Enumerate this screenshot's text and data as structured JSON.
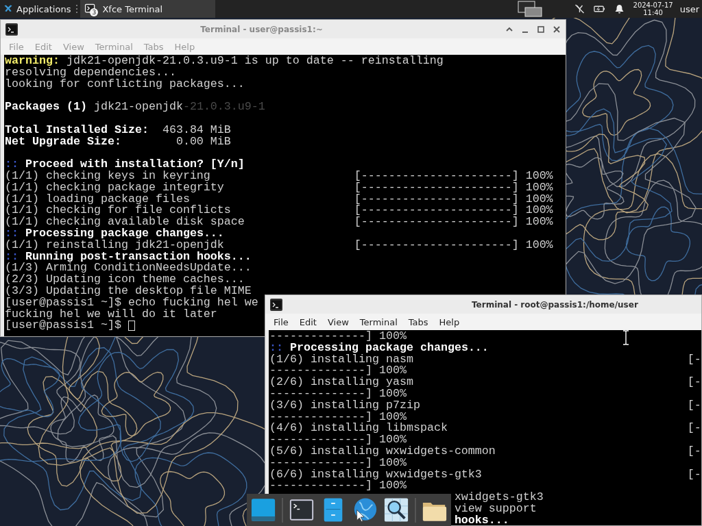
{
  "top_panel": {
    "applications": "Applications",
    "task": {
      "title": "Xfce Terminal",
      "badge": "3"
    },
    "date": "2024-07-17",
    "time": "11:40",
    "user": "user"
  },
  "windows": [
    {
      "title": "Terminal - user@passis1:~",
      "active": false,
      "window_buttons": true,
      "menu": [
        "File",
        "Edit",
        "View",
        "Terminal",
        "Tabs",
        "Help"
      ],
      "lines": [
        {
          "kind": "text",
          "segments": [
            {
              "text": "warning:",
              "kind": "warn"
            },
            {
              "text": " jdk21-openjdk-21.0.3.u9-1 is up to date -- reinstalling",
              "kind": "plain"
            }
          ]
        },
        {
          "kind": "text",
          "segments": [
            {
              "text": "resolving dependencies...",
              "kind": "plain"
            }
          ]
        },
        {
          "kind": "text",
          "segments": [
            {
              "text": "looking for conflicting packages...",
              "kind": "plain"
            }
          ]
        },
        {
          "kind": "blank"
        },
        {
          "kind": "text",
          "segments": [
            {
              "text": "Packages (1)",
              "kind": "bold"
            },
            {
              "text": " jdk21-openjdk",
              "kind": "plain"
            },
            {
              "text": "-21.0.3.u9-1",
              "kind": "dim"
            }
          ]
        },
        {
          "kind": "blank"
        },
        {
          "kind": "text",
          "segments": [
            {
              "text": "Total Installed Size:",
              "kind": "bold"
            },
            {
              "text": "  463.84 MiB",
              "kind": "plain"
            }
          ]
        },
        {
          "kind": "text",
          "segments": [
            {
              "text": "Net Upgrade Size:",
              "kind": "bold"
            },
            {
              "text": "        0.00 MiB",
              "kind": "plain"
            }
          ]
        },
        {
          "kind": "blank"
        },
        {
          "kind": "text",
          "segments": [
            {
              "text": "::",
              "kind": "accent"
            },
            {
              "text": " Proceed with installation? [Y/n]",
              "kind": "bold"
            }
          ]
        },
        {
          "kind": "progress",
          "label": "(1/1) checking keys in keyring",
          "bar": "[----------------------] 100%"
        },
        {
          "kind": "progress",
          "label": "(1/1) checking package integrity",
          "bar": "[----------------------] 100%"
        },
        {
          "kind": "progress",
          "label": "(1/1) loading package files",
          "bar": "[----------------------] 100%"
        },
        {
          "kind": "progress",
          "label": "(1/1) checking for file conflicts",
          "bar": "[----------------------] 100%"
        },
        {
          "kind": "progress",
          "label": "(1/1) checking available disk space",
          "bar": "[----------------------] 100%"
        },
        {
          "kind": "text",
          "segments": [
            {
              "text": "::",
              "kind": "accent"
            },
            {
              "text": " Processing package changes...",
              "kind": "bold"
            }
          ]
        },
        {
          "kind": "progress",
          "label": "(1/1) reinstalling jdk21-openjdk",
          "bar": "[----------------------] 100%"
        },
        {
          "kind": "text",
          "segments": [
            {
              "text": "::",
              "kind": "accent"
            },
            {
              "text": " Running post-transaction hooks...",
              "kind": "bold"
            }
          ]
        },
        {
          "kind": "text",
          "segments": [
            {
              "text": "(1/3) Arming ConditionNeedsUpdate...",
              "kind": "plain"
            }
          ]
        },
        {
          "kind": "text",
          "segments": [
            {
              "text": "(2/3) Updating icon theme caches...",
              "kind": "plain"
            }
          ]
        },
        {
          "kind": "text",
          "segments": [
            {
              "text": "(3/3) Updating the desktop file MIME",
              "kind": "plain"
            }
          ]
        },
        {
          "kind": "text",
          "segments": [
            {
              "text": "[user@passis1 ~]$ echo fucking hel we",
              "kind": "plain"
            }
          ]
        },
        {
          "kind": "text",
          "segments": [
            {
              "text": "fucking hel we will do it later",
              "kind": "plain"
            }
          ]
        },
        {
          "kind": "prompt",
          "segments": [
            {
              "text": "[user@passis1 ~]$",
              "kind": "plain"
            }
          ],
          "cursor": true
        }
      ]
    },
    {
      "title": "Terminal - root@passis1:/home/user",
      "active": true,
      "window_buttons": false,
      "menu": [
        "File",
        "Edit",
        "View",
        "Terminal",
        "Tabs",
        "Help"
      ],
      "lines": [
        {
          "kind": "text",
          "segments": [
            {
              "text": "--------------] 100%",
              "kind": "plain"
            }
          ]
        },
        {
          "kind": "text",
          "segments": [
            {
              "text": "::",
              "kind": "accent"
            },
            {
              "text": " Processing package changes...",
              "kind": "bold"
            }
          ]
        },
        {
          "kind": "progress",
          "label": "(1/6) installing nasm",
          "bar": "[-"
        },
        {
          "kind": "text",
          "segments": [
            {
              "text": "--------------] 100%",
              "kind": "plain"
            }
          ]
        },
        {
          "kind": "progress",
          "label": "(2/6) installing yasm",
          "bar": "[-"
        },
        {
          "kind": "text",
          "segments": [
            {
              "text": "--------------] 100%",
              "kind": "plain"
            }
          ]
        },
        {
          "kind": "progress",
          "label": "(3/6) installing p7zip",
          "bar": "[-"
        },
        {
          "kind": "text",
          "segments": [
            {
              "text": "--------------] 100%",
              "kind": "plain"
            }
          ]
        },
        {
          "kind": "progress",
          "label": "(4/6) installing libmspack",
          "bar": "[-"
        },
        {
          "kind": "text",
          "segments": [
            {
              "text": "--------------] 100%",
              "kind": "plain"
            }
          ]
        },
        {
          "kind": "progress",
          "label": "(5/6) installing wxwidgets-common",
          "bar": "[-"
        },
        {
          "kind": "text",
          "segments": [
            {
              "text": "--------------] 100%",
              "kind": "plain"
            }
          ]
        },
        {
          "kind": "progress",
          "label": "(6/6) installing wxwidgets-gtk3",
          "bar": "[-"
        },
        {
          "kind": "text",
          "segments": [
            {
              "text": "--------------] 100%",
              "kind": "plain"
            }
          ]
        },
        {
          "kind": "tail",
          "segments": [
            {
              "text": "xwidgets-gtk3",
              "kind": "plain"
            }
          ]
        },
        {
          "kind": "tail",
          "segments": [
            {
              "text": "view support",
              "kind": "plain"
            }
          ]
        },
        {
          "kind": "tail",
          "segments": [
            {
              "text": "hooks...",
              "kind": "bold"
            }
          ]
        }
      ]
    }
  ]
}
